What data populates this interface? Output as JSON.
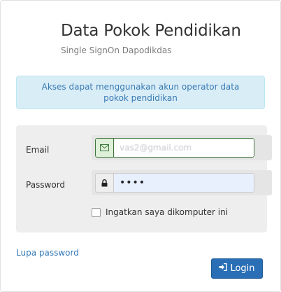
{
  "header": {
    "title": "Data Pokok Pendidikan",
    "subtitle": "Single SignOn Dapodikdas"
  },
  "alert": {
    "text": "Akses dapat menggunakan akun operator data pokok pendidikan"
  },
  "form": {
    "email_label": "Email",
    "email_value": "vas2@gmail.com",
    "email_icon": "envelope-icon",
    "password_label": "Password",
    "password_value": "••••",
    "password_icon": "lock-icon",
    "remember_label": "Ingatkan saya dikomputer ini"
  },
  "links": {
    "forgot_password": "Lupa password"
  },
  "actions": {
    "login_label": "Login",
    "login_icon": "sign-in-icon"
  },
  "colors": {
    "primary": "#2a6fb5",
    "alert_bg": "#d9edf7",
    "alert_text": "#3a7bb3",
    "success_border": "#3c763d"
  }
}
